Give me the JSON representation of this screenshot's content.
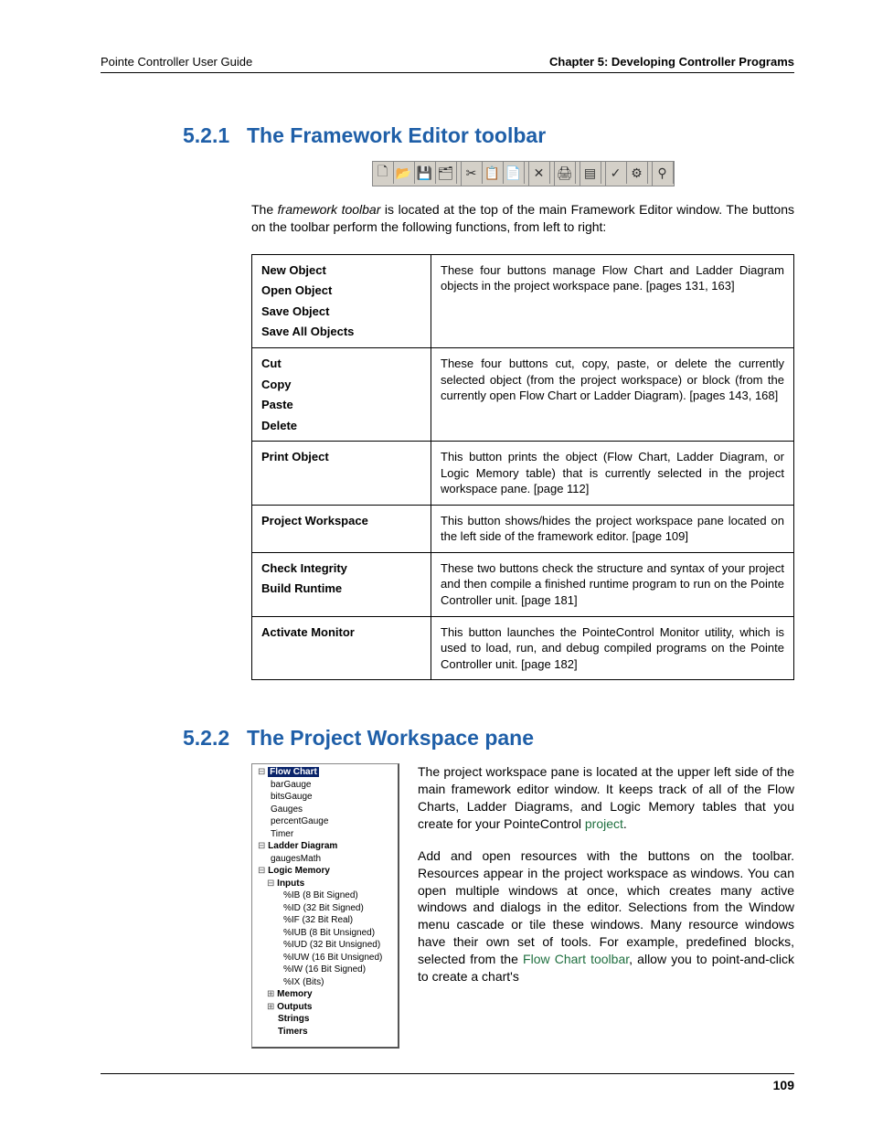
{
  "header": {
    "left": "Pointe Controller User Guide",
    "right": "Chapter 5: Developing Controller Programs"
  },
  "section521": {
    "num": "5.2.1",
    "title": "The Framework Editor toolbar",
    "intro_before": "The ",
    "intro_ital": "framework toolbar",
    "intro_after": " is located at the top of the main Framework Editor window. The buttons on the toolbar perform the following functions, from left to right:",
    "rows": [
      {
        "left": [
          "New Object",
          "Open Object",
          "Save Object",
          "Save All Objects"
        ],
        "right": "These four buttons manage Flow Chart and Ladder Diagram objects in the project workspace pane. [pages 131, 163]"
      },
      {
        "left": [
          "Cut",
          "Copy",
          "Paste",
          "Delete"
        ],
        "right": "These four buttons cut, copy, paste, or delete the currently selected object (from the project workspace) or block (from the currently open Flow Chart or Ladder Diagram). [pages 143, 168]"
      },
      {
        "left": [
          "Print Object"
        ],
        "right": "This button prints the object (Flow Chart, Ladder Diagram, or Logic Memory table) that is currently selected in the project workspace pane. [page 112]"
      },
      {
        "left": [
          "Project Workspace"
        ],
        "right": "This button shows/hides the project workspace pane located on the left side of the framework editor. [page 109]"
      },
      {
        "left": [
          "Check Integrity",
          "Build Runtime"
        ],
        "right": "These two buttons check the structure and syntax of your project and then compile a finished runtime program to run on the Pointe Controller unit. [page 181]"
      },
      {
        "left": [
          "Activate Monitor"
        ],
        "right": "This button launches the PointeControl Monitor utility, which is used to load, run, and debug compiled programs on the Pointe Controller unit. [page 182]"
      }
    ]
  },
  "section522": {
    "num": "5.2.2",
    "title": "The Project Workspace pane",
    "p1_before": "The ",
    "p1_ital": "project workspace pane",
    "p1_after": " is located at the upper left side of the main framework editor window. It keeps track of all of the Flow Charts, Ladder Diagrams, and Logic Memory tables that you create for your PointeControl ",
    "p1_link": "project",
    "p1_end": ".",
    "p2_a": "Add and open resources with the buttons on the toolbar. Resources appear in the project workspace as windows. You can open multiple windows at once, which creates many active windows and dialogs in the editor. Selections from the Window menu cascade or tile these windows. Many resource windows have their own set of tools. For example, predefined blocks, selected from the ",
    "p2_link": "Flow Chart toolbar",
    "p2_b": ", allow you to point-and-click to create a chart's"
  },
  "tree": {
    "flow_chart": "Flow Chart",
    "items_fc": [
      "barGauge",
      "bitsGauge",
      "Gauges",
      "percentGauge",
      "Timer"
    ],
    "ladder": "Ladder Diagram",
    "items_ld": [
      "gaugesMath"
    ],
    "logic": "Logic Memory",
    "inputs": "Inputs",
    "input_items": [
      "%IB (8 Bit Signed)",
      "%ID (32 Bit Signed)",
      "%IF (32 Bit Real)",
      "%IUB (8 Bit Unsigned)",
      "%IUD (32 Bit Unsigned)",
      "%IUW (16 Bit Unsigned)",
      "%IW (16 Bit Signed)",
      "%IX (Bits)"
    ],
    "memory": "Memory",
    "outputs": "Outputs",
    "strings": "Strings",
    "timers": "Timers"
  },
  "footer": {
    "page": "109"
  }
}
